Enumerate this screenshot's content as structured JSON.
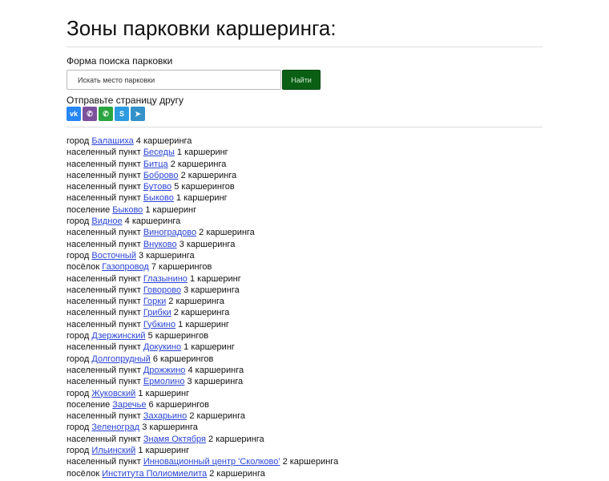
{
  "page": {
    "title": "Зоны парковки каршеринга:"
  },
  "search": {
    "label": "Форма поиска парковки",
    "placeholder": "Искать место парковки",
    "button_label": "Найти"
  },
  "share": {
    "label": "Отправьте страницу другу",
    "buttons": [
      {
        "name": "vk",
        "glyph": "vk",
        "color": "#2787f5"
      },
      {
        "name": "viber",
        "glyph": "✆",
        "color": "#7b519d"
      },
      {
        "name": "whatsapp",
        "glyph": "✆",
        "color": "#2ba53f"
      },
      {
        "name": "skype",
        "glyph": "S",
        "color": "#2d9be0"
      },
      {
        "name": "telegram",
        "glyph": "➤",
        "color": "#3392c9"
      }
    ]
  },
  "colors": {
    "link": "#2a44d6",
    "button_bg": "#0a5f14",
    "divider": "#dcdcdc"
  },
  "locations": [
    {
      "prefix": "город",
      "name": "Балашиха",
      "count": "4 каршеринга"
    },
    {
      "prefix": "населенный пункт",
      "name": "Беседы",
      "count": "1 каршеринг"
    },
    {
      "prefix": "населенный пункт",
      "name": "Битца",
      "count": "2 каршеринга"
    },
    {
      "prefix": "населенный пункт",
      "name": "Боброво",
      "count": "2 каршеринга"
    },
    {
      "prefix": "населенный пункт",
      "name": "Бутово",
      "count": "5 каршерингов"
    },
    {
      "prefix": "населенный пункт",
      "name": "Быково",
      "count": "1 каршеринг"
    },
    {
      "prefix": "поселение",
      "name": "Быково",
      "count": "1 каршеринг"
    },
    {
      "prefix": "город",
      "name": "Видное",
      "count": "4 каршеринга"
    },
    {
      "prefix": "населенный пункт",
      "name": "Виноградово",
      "count": "2 каршеринга"
    },
    {
      "prefix": "населенный пункт",
      "name": "Внуково",
      "count": "3 каршеринга"
    },
    {
      "prefix": "город",
      "name": "Восточный",
      "count": "3 каршеринга"
    },
    {
      "prefix": "посёлок",
      "name": "Газопровод",
      "count": "7 каршерингов"
    },
    {
      "prefix": "населенный пункт",
      "name": "Глазынино",
      "count": "1 каршеринг"
    },
    {
      "prefix": "населенный пункт",
      "name": "Говорово",
      "count": "3 каршеринга"
    },
    {
      "prefix": "населенный пункт",
      "name": "Горки",
      "count": "2 каршеринга"
    },
    {
      "prefix": "населенный пункт",
      "name": "Грибки",
      "count": "2 каршеринга"
    },
    {
      "prefix": "населенный пункт",
      "name": "Губкино",
      "count": "1 каршеринг"
    },
    {
      "prefix": "город",
      "name": "Дзержинский",
      "count": "5 каршерингов"
    },
    {
      "prefix": "населенный пункт",
      "name": "Докукино",
      "count": "1 каршеринг"
    },
    {
      "prefix": "город",
      "name": "Долгопрудный",
      "count": "6 каршерингов"
    },
    {
      "prefix": "населенный пункт",
      "name": "Дрожжино",
      "count": "4 каршеринга"
    },
    {
      "prefix": "населенный пункт",
      "name": "Ермолино",
      "count": "3 каршеринга"
    },
    {
      "prefix": "город",
      "name": "Жуковский",
      "count": "1 каршеринг"
    },
    {
      "prefix": "поселение",
      "name": "Заречье",
      "count": "6 каршерингов"
    },
    {
      "prefix": "населенный пункт",
      "name": "Захарьино",
      "count": "2 каршеринга"
    },
    {
      "prefix": "город",
      "name": "Зеленоград",
      "count": "3 каршеринга"
    },
    {
      "prefix": "населенный пункт",
      "name": "Знамя Октября",
      "count": "2 каршеринга"
    },
    {
      "prefix": "город",
      "name": "Ильинский",
      "count": "1 каршеринг"
    },
    {
      "prefix": "населенный пункт",
      "name": "Инновационный центр 'Сколково'",
      "count": "2 каршеринга"
    },
    {
      "prefix": "посёлок",
      "name": "Института Полиомиелита",
      "count": "2 каршеринга"
    }
  ]
}
